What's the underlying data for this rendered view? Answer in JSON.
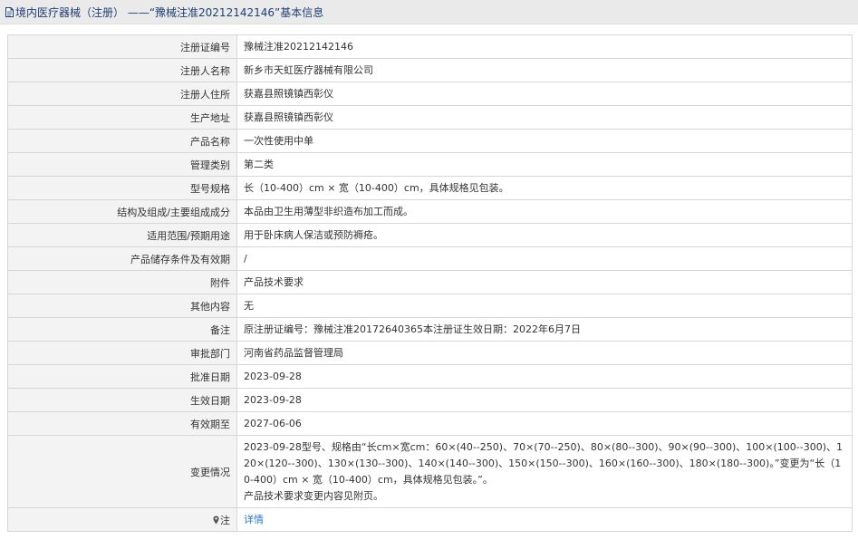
{
  "header": {
    "title": "境内医疗器械（注册） ——“豫械注准20212142146”基本信息"
  },
  "rows": [
    {
      "label": "注册证编号",
      "value": "豫械注准20212142146"
    },
    {
      "label": "注册人名称",
      "value": "新乡市天虹医疗器械有限公司"
    },
    {
      "label": "注册人住所",
      "value": "获嘉县照镜镇西彰仪"
    },
    {
      "label": "生产地址",
      "value": "获嘉县照镜镇西彰仪"
    },
    {
      "label": "产品名称",
      "value": "一次性使用中单"
    },
    {
      "label": "管理类别",
      "value": "第二类"
    },
    {
      "label": "型号规格",
      "value": "长（10-400）cm × 宽（10-400）cm，具体规格见包装。"
    },
    {
      "label": "结构及组成/主要组成成分",
      "value": "本品由卫生用薄型非织造布加工而成。"
    },
    {
      "label": "适用范围/预期用途",
      "value": "用于卧床病人保洁或预防褥疮。"
    },
    {
      "label": "产品储存条件及有效期",
      "value": "/"
    },
    {
      "label": "附件",
      "value": "产品技术要求"
    },
    {
      "label": "其他内容",
      "value": "无"
    },
    {
      "label": "备注",
      "value": "原注册证编号：豫械注准20172640365本注册证生效日期：2022年6月7日"
    },
    {
      "label": "审批部门",
      "value": "河南省药品监督管理局"
    },
    {
      "label": "批准日期",
      "value": "2023-09-28"
    },
    {
      "label": "生效日期",
      "value": "2023-09-28"
    },
    {
      "label": "有效期至",
      "value": "2027-06-06"
    }
  ],
  "change": {
    "label": "变更情况",
    "line1": "2023-09-28型号、规格由“长cm×宽cm：60×(40--250)、70×(70--250)、80×(80--300)、90×(90--300)、100×(100--300)、120×(120--300)、130×(130--300)、140×(140--300)、150×(150--300)、160×(160--300)、180×(180--300)。”变更为“长（10-400）cm × 宽（10-400）cm，具体规格见包装。”。",
    "line2": "产品技术要求变更内容见附页。"
  },
  "note": {
    "label": "注",
    "link_text": "详情"
  },
  "icons": {
    "title": "document-icon",
    "note": "map-pin-icon"
  },
  "colors": {
    "title_text": "#1e3f73",
    "link": "#2a78c8",
    "label_bg": "#f3f3f3",
    "header_bg": "#eaeaea",
    "border": "#d6d6d6"
  }
}
